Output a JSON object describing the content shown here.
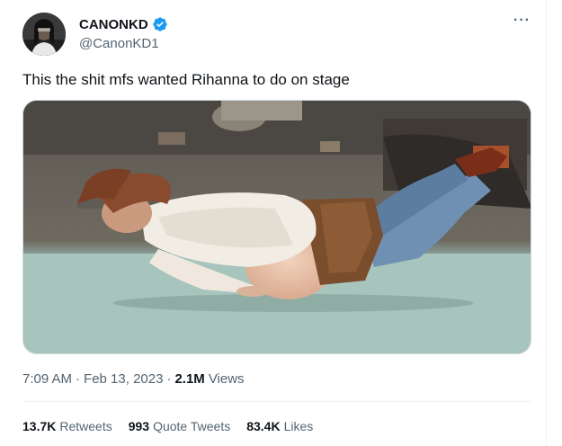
{
  "author": {
    "display_name": "CANONKD",
    "handle": "@CanonKD1",
    "verified_icon": "verified-badge-icon",
    "avatar_icon": "avatar"
  },
  "more_icon": "more-options-icon",
  "more_glyph": "···",
  "tweet": {
    "text": "This the shit mfs wanted Rihanna to do on stage"
  },
  "meta": {
    "time": "7:09 AM",
    "separator1": "·",
    "date": "Feb 13, 2023",
    "separator2": "·",
    "views_count": "2.1M",
    "views_label": "Views"
  },
  "stats": {
    "retweets_count": "13.7K",
    "retweets_label": "Retweets",
    "quotes_count": "993",
    "quotes_label": "Quote Tweets",
    "likes_count": "83.4K",
    "likes_label": "Likes"
  },
  "colors": {
    "verified": "#1d9bf0",
    "secondary_text": "#536471",
    "primary_text": "#0f1419",
    "border": "#eff3f4"
  }
}
